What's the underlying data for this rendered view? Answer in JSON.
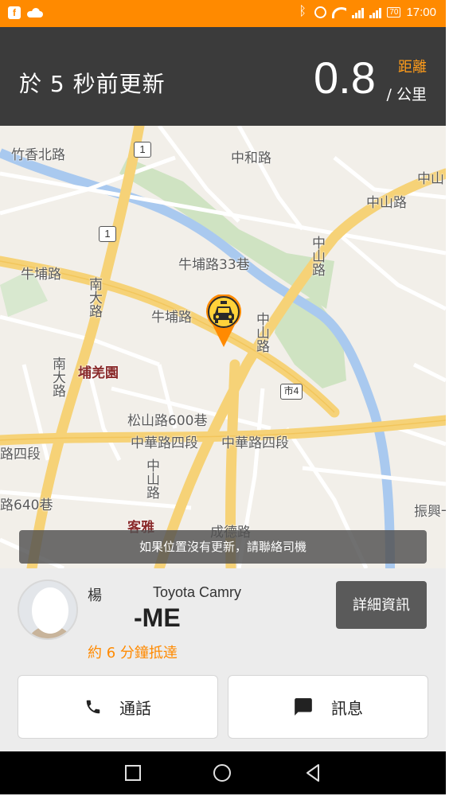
{
  "status_bar": {
    "left_icons": [
      "facebook-icon",
      "cloud-icon"
    ],
    "right_icons": [
      "bluetooth-icon",
      "alarm-icon",
      "wifi-icon",
      "signal-icon",
      "signal-icon",
      "battery-icon"
    ],
    "battery": "70",
    "time": "17:00",
    "color": "#ff8a00"
  },
  "header": {
    "updated_text": "於 5 秒前更新",
    "distance_label": "距離",
    "distance_value": "0.8",
    "distance_unit": "/ 公里",
    "accent_color": "#ff9c1a"
  },
  "map": {
    "labels": {
      "zhuxiang_north_rd": "竹香北路",
      "zhonghe_rd": "中和路",
      "zhongshan_rd_ne": "中山路",
      "zhongshan_rd_ne2": "中山",
      "niupu_rd": "牛埔路",
      "niupu_rd_lane33": "牛埔路33巷",
      "niupu_rd_mid": "牛埔路",
      "zhongshan_rd_v1": "中山路",
      "zhongshan_rd_v2": "中山路",
      "nanda_rd": "南大路",
      "nanda_rd2": "南大路",
      "pujian_district": "埔羌園",
      "songshan_lane600": "松山路600巷",
      "zhonghua_rd_4_a": "中華路四段",
      "zhonghua_rd_4_b": "中華路四段",
      "rd_4_left": "路四段",
      "lane640": "路640巷",
      "keya_district": "客雅",
      "zhongshan_rd_low": "中山路",
      "chengde_rd": "成德路",
      "zhenxing_rd": "振興一"
    },
    "shields": {
      "route_1_top": "1",
      "route_1_mid": "1",
      "city_4": "市4"
    },
    "toast": "如果位置沒有更新，請聯絡司機"
  },
  "driver": {
    "name": "楊",
    "car_model": "Toyota Camry",
    "plate": "-ME",
    "eta": "約 6 分鐘抵達",
    "detail_button": "詳細資訊",
    "eta_color": "#ff8a00"
  },
  "actions": {
    "call_label": "通話",
    "message_label": "訊息"
  },
  "nav_bar": {
    "buttons": [
      "recent-apps-button",
      "home-button",
      "back-button"
    ]
  }
}
